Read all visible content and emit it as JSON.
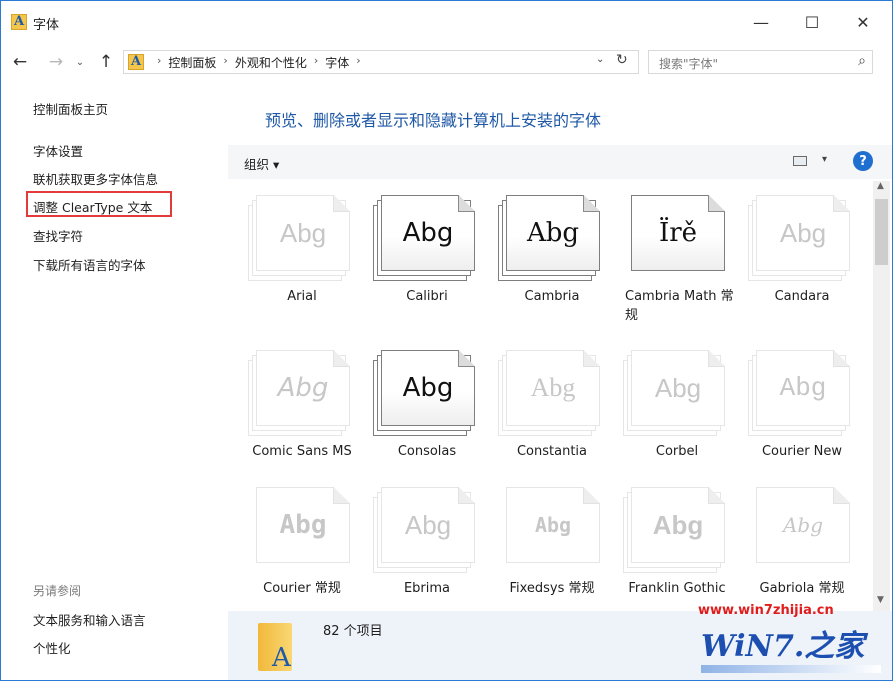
{
  "window": {
    "title": "字体",
    "app_icon_letter": "A",
    "minimize": "—",
    "maximize": "☐",
    "close": "✕"
  },
  "nav": {
    "back": "←",
    "forward": "→",
    "recent": "⌄",
    "up": "↑",
    "breadcrumbs": [
      "控制面板",
      "外观和个性化",
      "字体"
    ],
    "separator": "›",
    "dropdown": "⌄",
    "refresh": "↻",
    "search_placeholder": "搜索\"字体\"",
    "search_icon": "⌕"
  },
  "sidebar": {
    "links": [
      "控制面板主页",
      "字体设置",
      "联机获取更多字体信息",
      "调整 ClearType 文本",
      "查找字符",
      "下载所有语言的字体"
    ],
    "highlighted_index": 3,
    "see_also_title": "另请参阅",
    "see_also_links": [
      "文本服务和输入语言",
      "个性化"
    ]
  },
  "main": {
    "heading": "预览、删除或者显示和隐藏计算机上安装的字体",
    "organize_label": "组织 ▾",
    "view_icon": "view-icon",
    "view_dropdown": "▾",
    "help": "?"
  },
  "fonts": [
    {
      "name": "Arial",
      "sample": "Abg",
      "family_type": "family"
    },
    {
      "name": "Calibri",
      "sample": "Abg",
      "family_type": "family"
    },
    {
      "name": "Cambria",
      "sample": "Abg",
      "family_type": "family"
    },
    {
      "name": "Cambria Math 常规",
      "sample": "Ïrě",
      "family_type": "single"
    },
    {
      "name": "Candara",
      "sample": "Abg",
      "family_type": "family"
    },
    {
      "name": "Comic Sans MS",
      "sample": "Abg",
      "family_type": "family"
    },
    {
      "name": "Consolas",
      "sample": "Abg",
      "family_type": "family"
    },
    {
      "name": "Constantia",
      "sample": "Abg",
      "family_type": "family"
    },
    {
      "name": "Corbel",
      "sample": "Abg",
      "family_type": "family"
    },
    {
      "name": "Courier New",
      "sample": "Abg",
      "family_type": "family"
    },
    {
      "name": "Courier 常规",
      "sample": "Abg",
      "family_type": "single"
    },
    {
      "name": "Ebrima",
      "sample": "Abg",
      "family_type": "family"
    },
    {
      "name": "Fixedsys 常规",
      "sample": "Abg",
      "family_type": "single"
    },
    {
      "name": "Franklin Gothic",
      "sample": "Abg",
      "family_type": "family"
    },
    {
      "name": "Gabriola 常规",
      "sample": "Abg",
      "family_type": "single"
    }
  ],
  "details": {
    "count": "82 个项目"
  },
  "watermark": {
    "url": "www.win7zhijia.cn",
    "logo": "WiN7.之家"
  },
  "colors": {
    "accent": "#1f58a6",
    "highlight_border": "#e33b3b",
    "window_border": "#2b7bd6"
  }
}
